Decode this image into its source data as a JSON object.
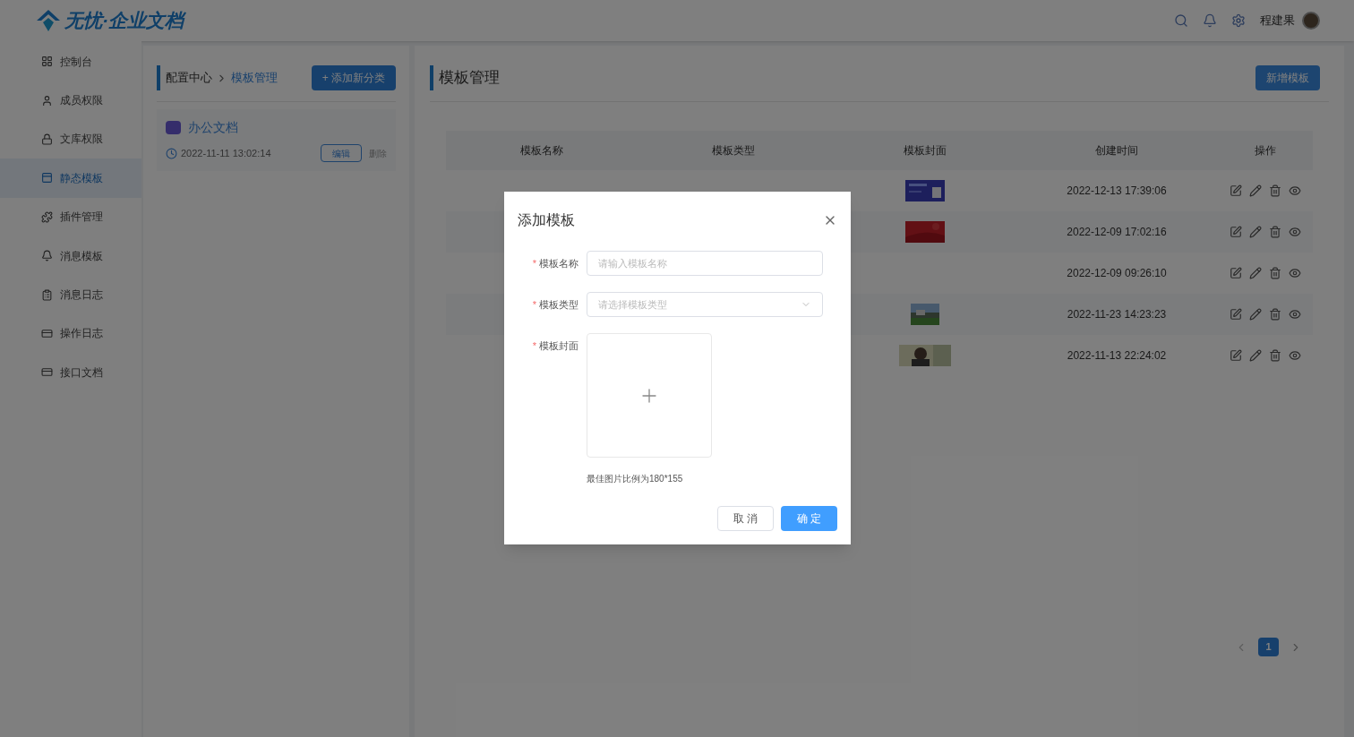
{
  "header": {
    "logo_text": "无忧·企业文档",
    "user_name": "程建果"
  },
  "sidebar": {
    "items": [
      {
        "label": "控制台",
        "selected": false
      },
      {
        "label": "成员权限",
        "selected": false
      },
      {
        "label": "文库权限",
        "selected": false
      },
      {
        "label": "静态模板",
        "selected": true
      },
      {
        "label": "插件管理",
        "selected": false
      },
      {
        "label": "消息模板",
        "selected": false
      },
      {
        "label": "消息日志",
        "selected": false
      },
      {
        "label": "操作日志",
        "selected": false
      },
      {
        "label": "接口文档",
        "selected": false
      }
    ]
  },
  "categories": {
    "breadcrumb": [
      "配置中心",
      "模板管理"
    ],
    "add_button": "+ 添加新分类",
    "items": [
      {
        "name": "办公文档",
        "time": "2022-11-11 13:02:14",
        "edit": "编辑",
        "delete": "删除"
      }
    ]
  },
  "templates": {
    "title": "模板管理",
    "add_button": "新增模板",
    "columns": [
      "模板名称",
      "模板类型",
      "模板封面",
      "创建时间",
      "操作"
    ],
    "rows": [
      {
        "has_cover": true,
        "created": "2022-12-13 17:39:06"
      },
      {
        "has_cover": true,
        "created": "2022-12-09 17:02:16"
      },
      {
        "has_cover": false,
        "created": "2022-12-09 09:26:10"
      },
      {
        "has_cover": true,
        "created": "2022-11-23 14:23:23"
      },
      {
        "has_cover": true,
        "created": "2022-11-13 22:24:02"
      }
    ],
    "pagination": {
      "pages": [
        {
          "label": "1",
          "selected": true
        }
      ]
    }
  },
  "dialog": {
    "title": "添加模板",
    "fields": [
      {
        "kind": "input",
        "required_mark": "*",
        "label": "模板名称",
        "placeholder": "请输入模板名称"
      },
      {
        "kind": "select",
        "required_mark": "*",
        "label": "模板类型",
        "placeholder": "请选择模板类型"
      },
      {
        "kind": "upload",
        "required_mark": "*",
        "label": "模板封面",
        "hint": "最佳图片比例为180*155"
      }
    ],
    "buttons": [
      {
        "label": "取 消",
        "primary": false
      },
      {
        "label": "确 定",
        "primary": true
      }
    ]
  }
}
